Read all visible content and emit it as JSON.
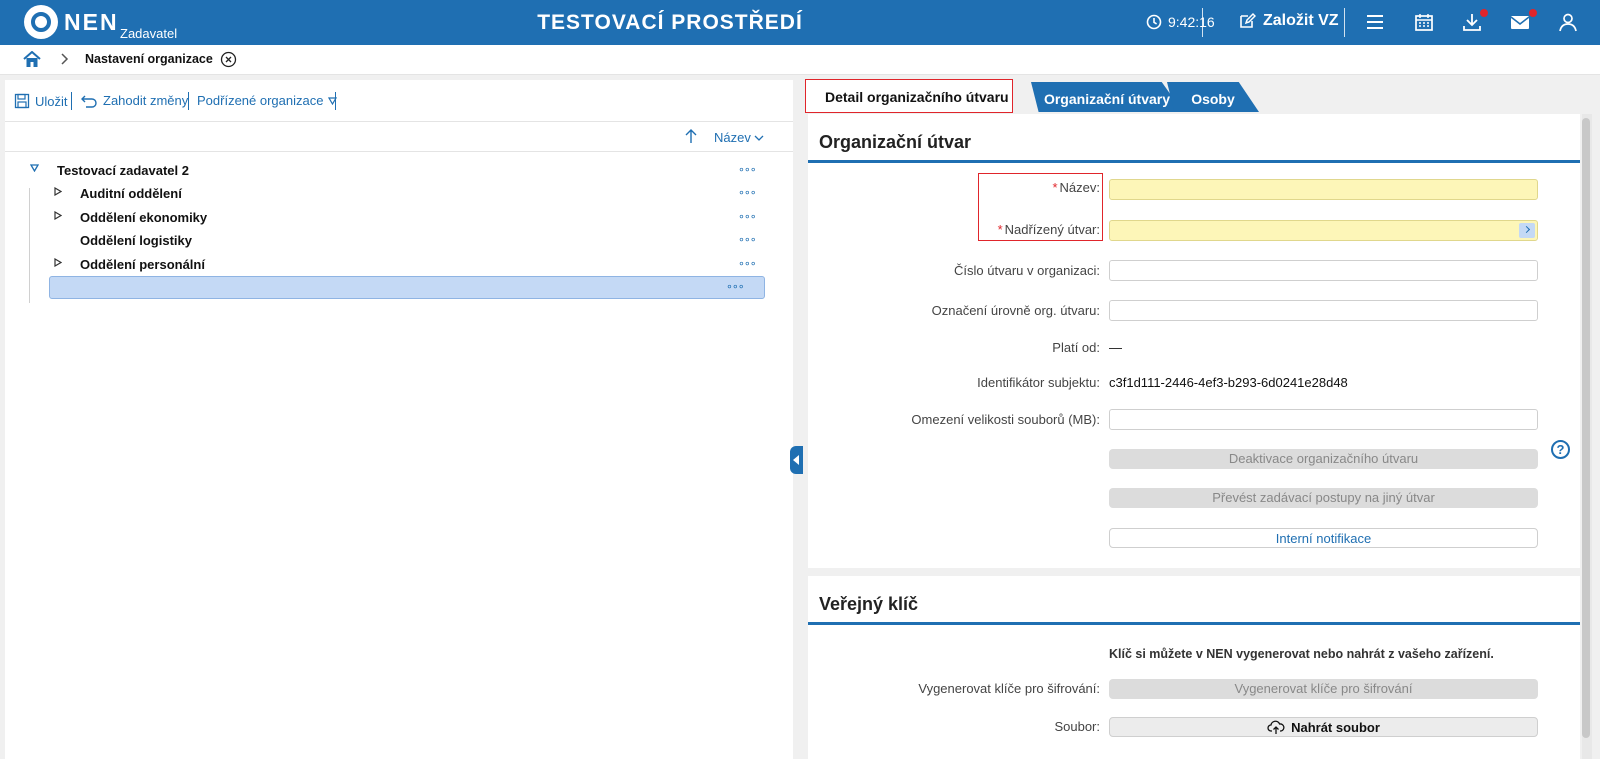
{
  "header": {
    "brand": "NEN",
    "brand_sub": "Zadavatel",
    "environment_title": "TESTOVACÍ PROSTŘEDÍ",
    "time": "9:42:16",
    "create_label": "Založit VZ",
    "icons": [
      "clock-icon",
      "edit-icon",
      "menu-icon",
      "calendar-icon",
      "download-icon",
      "mail-icon",
      "user-icon"
    ],
    "accent_color": "#1f6fb2",
    "notification_color": "#e0252b"
  },
  "breadcrumb": {
    "title": "Nastavení organizace"
  },
  "toolbar": {
    "save_label": "Uložit",
    "discard_label": "Zahodit změny",
    "sub_orgs_label": "Podřízené organizace"
  },
  "tree": {
    "sort_label": "Název",
    "root": "Testovací zadavatel 2",
    "items": [
      {
        "label": "Auditní oddělení",
        "expandable": true
      },
      {
        "label": "Oddělení ekonomiky",
        "expandable": true
      },
      {
        "label": "Oddělení logistiky",
        "expandable": false
      },
      {
        "label": "Oddělení personální",
        "expandable": true
      },
      {
        "label": "",
        "expandable": false,
        "selected": true
      }
    ],
    "more_glyph": "∘∘∘"
  },
  "tabs": {
    "active": "Detail organizačního útvaru",
    "tab1": "Organizační útvary",
    "tab2": "Osoby"
  },
  "org_unit": {
    "title": "Organizační útvar",
    "required_mark": "*",
    "name_label": "Název:",
    "parent_label": "Nadřízený útvar:",
    "number_label": "Číslo útvaru v organizaci:",
    "level_label": "Označení úrovně org. útvaru:",
    "valid_from_label": "Platí od:",
    "valid_from_value": "—",
    "subject_id_label": "Identifikátor subjektu:",
    "subject_id_value": "c3f1d111-2446-4ef3-b293-6d0241e28d48",
    "file_limit_label": "Omezení velikosti souborů (MB):",
    "help_glyph": "?",
    "deactivate_label": "Deaktivace organizačního útvaru",
    "transfer_label": "Převést zadávací postupy na jiný útvar",
    "notifications_label": "Interní notifikace"
  },
  "public_key": {
    "title": "Veřejný klíč",
    "info": "Klíč si můžete v NEN vygenerovat nebo nahrát z vašeho zařízení.",
    "generate_label": "Vygenerovat klíče pro šifrování:",
    "generate_button": "Vygenerovat klíče pro šifrování",
    "file_label": "Soubor:",
    "upload_button": "Nahrát soubor"
  }
}
